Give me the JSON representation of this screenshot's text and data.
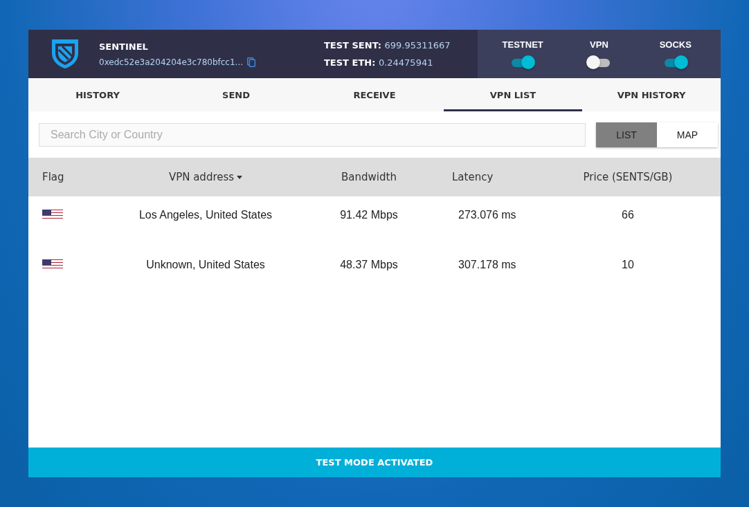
{
  "brand": {
    "name": "SENTINEL",
    "address": "0xedc52e3a204204e3c780bfcc1..."
  },
  "balances": [
    {
      "label": "TEST SENT:",
      "value": "699.95311667"
    },
    {
      "label": "TEST ETH:",
      "value": "0.24475941"
    }
  ],
  "toggles": [
    {
      "label": "TESTNET",
      "on": true
    },
    {
      "label": "VPN",
      "on": false
    },
    {
      "label": "SOCKS",
      "on": true
    }
  ],
  "tabs": [
    {
      "label": "HISTORY",
      "selected": false
    },
    {
      "label": "SEND",
      "selected": false
    },
    {
      "label": "RECEIVE",
      "selected": false
    },
    {
      "label": "VPN LIST",
      "selected": true
    },
    {
      "label": "VPN HISTORY",
      "selected": false
    }
  ],
  "search": {
    "placeholder": "Search City or Country"
  },
  "view_buttons": [
    {
      "label": "LIST",
      "selected": true
    },
    {
      "label": "MAP",
      "selected": false
    }
  ],
  "table": {
    "columns": [
      "Flag",
      "VPN address",
      "Bandwidth",
      "Latency",
      "Price (SENTS/GB)"
    ],
    "rows": [
      {
        "address": "Los Angeles, United States",
        "bandwidth": "91.42 Mbps",
        "latency": "273.076 ms",
        "price": "66"
      },
      {
        "address": "Unknown, United States",
        "bandwidth": "48.37 Mbps",
        "latency": "307.178 ms",
        "price": "10"
      }
    ]
  },
  "status_bar": "TEST MODE ACTIVATED"
}
